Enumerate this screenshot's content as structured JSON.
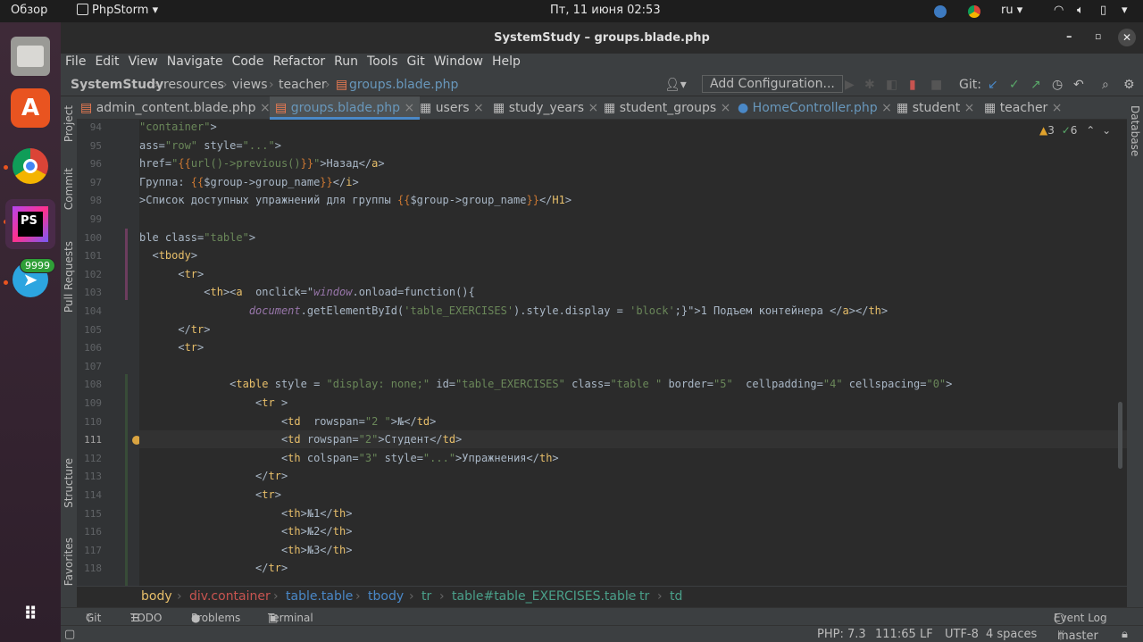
{
  "topbar": {
    "activities": "Обзор",
    "app_name": "PhpStorm",
    "clock": "Пт, 11 июня  02:53",
    "lang": "ru"
  },
  "dock": {
    "telegram_badge": "9999"
  },
  "window": {
    "title": "SystemStudy – groups.blade.php"
  },
  "menu": [
    "File",
    "Edit",
    "View",
    "Navigate",
    "Code",
    "Refactor",
    "Run",
    "Tools",
    "Git",
    "Window",
    "Help"
  ],
  "breadcrumb": {
    "items": [
      "SystemStudy",
      "resources",
      "views",
      "teacher",
      "groups.blade.php"
    ],
    "add_config": "Add Configuration...",
    "git_label": "Git:"
  },
  "tabs": [
    {
      "label": "admin_content.blade.php",
      "icon": "blade-icon"
    },
    {
      "label": "groups.blade.php",
      "icon": "blade-icon"
    },
    {
      "label": "users",
      "icon": "table-icon"
    },
    {
      "label": "study_years",
      "icon": "table-icon"
    },
    {
      "label": "student_groups",
      "icon": "table-icon"
    },
    {
      "label": "HomeController.php",
      "icon": "class-icon"
    },
    {
      "label": "student",
      "icon": "table-icon"
    },
    {
      "label": "teacher",
      "icon": "table-icon"
    }
  ],
  "inspections": {
    "warnings": "3",
    "weak": "6"
  },
  "left_tool_windows": [
    "Project",
    "Commit",
    "Pull Requests",
    "Structure",
    "Favorites"
  ],
  "right_tool_windows": [
    "Database"
  ],
  "editor": {
    "current_line": "111",
    "lines": [
      {
        "n": "94",
        "code": "\"container\">"
      },
      {
        "n": "95",
        "code": "ass=\"row\" style=\"...\">"
      },
      {
        "n": "96",
        "code": "href=\"{{url()->previous()}}\">Назад</a>"
      },
      {
        "n": "97",
        "code": "Группа: {{$group->group_name}}</i>"
      },
      {
        "n": "98",
        "code": ">Список доступных упражнений для группы {{$group->group_name}}</H1>"
      },
      {
        "n": "99",
        "code": ""
      },
      {
        "n": "100",
        "code": "ble class=\"table\">"
      },
      {
        "n": "101",
        "code": "  <tbody>"
      },
      {
        "n": "102",
        "code": "      <tr>"
      },
      {
        "n": "103",
        "code": "          <th><a  onclick=\"window.onload=function(){"
      },
      {
        "n": "104",
        "code": "                 document.getElementById('table_EXERCISES').style.display = 'block';}\">1 Подъем контейнера </a></th>"
      },
      {
        "n": "105",
        "code": "      </tr>"
      },
      {
        "n": "106",
        "code": "      <tr>"
      },
      {
        "n": "107",
        "code": ""
      },
      {
        "n": "108",
        "code": "              <table style = \"display: none;\" id=\"table_EXERCISES\" class=\"table \" border=\"5\"  cellpadding=\"4\" cellspacing=\"0\">"
      },
      {
        "n": "109",
        "code": "                  <tr >"
      },
      {
        "n": "110",
        "code": "                      <td  rowspan=\"2 \">№</td>"
      },
      {
        "n": "111",
        "code": "                      <td rowspan=\"2\">Студент</td>"
      },
      {
        "n": "112",
        "code": "                      <th colspan=\"3\" style=\"...\">Упражнения</th>"
      },
      {
        "n": "113",
        "code": "                  </tr>"
      },
      {
        "n": "114",
        "code": "                  <tr>"
      },
      {
        "n": "115",
        "code": "                      <th>№1</th>"
      },
      {
        "n": "116",
        "code": "                      <th>№2</th>"
      },
      {
        "n": "117",
        "code": "                      <th>№3</th>"
      },
      {
        "n": "118",
        "code": "                  </tr>"
      }
    ]
  },
  "structure_path": [
    "body",
    "div.container",
    "table.table",
    "tbody",
    "tr",
    "table#table_EXERCISES.table",
    "tr",
    "td"
  ],
  "tool_windows_bottom": [
    "Git",
    "TODO",
    "Problems",
    "Terminal"
  ],
  "event_log": "Event Log",
  "status": {
    "php": "PHP: 7.3",
    "position": "111:65",
    "line_sep": "LF",
    "encoding": "UTF-8",
    "indent": "4 spaces",
    "branch": "master"
  },
  "colors": {
    "accent": "#4a88c7",
    "tag": "#e8bf6a",
    "attr_value": "#6a8759",
    "keyword": "#cc7832",
    "ubuntu_orange": "#e95420"
  }
}
